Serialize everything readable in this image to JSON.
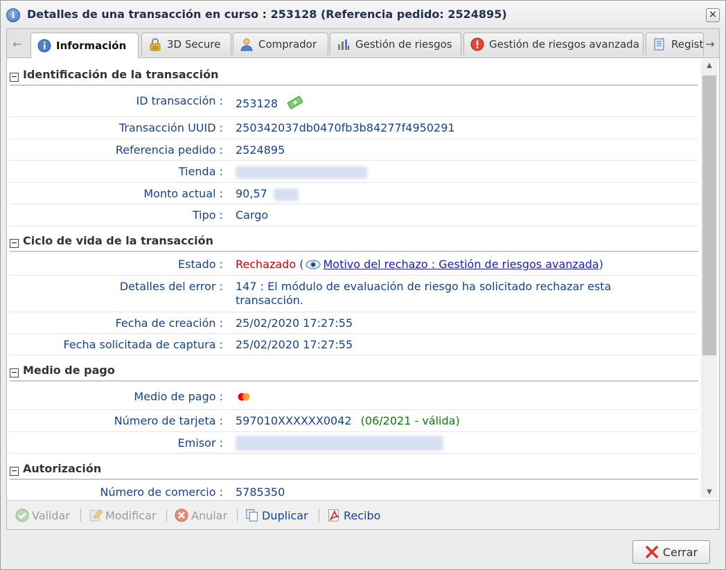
{
  "window": {
    "title": "Detalles de una transacción en curso : 253128 (Referencia pedido: 2524895)"
  },
  "tabs": [
    {
      "label": "Información",
      "icon": "info-icon",
      "active": true
    },
    {
      "label": "3D Secure",
      "icon": "3d-secure-icon",
      "active": false
    },
    {
      "label": "Comprador",
      "icon": "user-icon",
      "active": false
    },
    {
      "label": "Gestión de riesgos",
      "icon": "risk-chart-icon",
      "active": false
    },
    {
      "label": "Gestión de riesgos avanzada",
      "icon": "alert-icon",
      "active": false
    },
    {
      "label": "Regist",
      "icon": "log-icon",
      "active": false
    }
  ],
  "sections": {
    "identificacion": {
      "title": "Identificación de la transacción",
      "rows": [
        {
          "label": "ID transacción :",
          "value": "253128"
        },
        {
          "label": "Transacción UUID :",
          "value": "250342037db0470fb3b84277f4950291"
        },
        {
          "label": "Referencia pedido :",
          "value": "2524895"
        },
        {
          "label": "Tienda :",
          "value": ""
        },
        {
          "label": "Monto actual :",
          "value": "90,57"
        },
        {
          "label": "Tipo :",
          "value": "Cargo"
        }
      ]
    },
    "ciclo": {
      "title": "Ciclo de vida de la transacción",
      "estado_label": "Estado :",
      "estado_value": "Rechazado",
      "estado_paren_open": "(",
      "estado_link": "Motivo del rechazo : Gestión de riesgos avanzada",
      "estado_paren_close": ")",
      "error_label": "Detalles del error :",
      "error_value": "147 : El módulo de evaluación de riesgo ha solicitado rechazar esta transacción.",
      "creacion_label": "Fecha de creación :",
      "creacion_value": "25/02/2020 17:27:55",
      "captura_label": "Fecha solicitada de captura :",
      "captura_value": "25/02/2020 17:27:55"
    },
    "medio": {
      "title": "Medio de pago",
      "medio_label": "Medio de pago :",
      "tarjeta_label": "Número de tarjeta :",
      "tarjeta_value": "597010XXXXXX0042",
      "tarjeta_validity": "(06/2021 - válida)",
      "emisor_label": "Emisor :"
    },
    "autorizacion": {
      "title": "Autorización",
      "comercio_label": "Número de comercio :",
      "comercio_value": "5785350"
    }
  },
  "toolbar": {
    "validar": "Validar",
    "modificar": "Modificar",
    "anular": "Anular",
    "duplicar": "Duplicar",
    "recibo": "Recibo"
  },
  "footer": {
    "cerrar": "Cerrar"
  },
  "colors": {
    "label_blue": "#15428b",
    "status_red": "#d40000",
    "valid_green": "#0b7b0b"
  }
}
